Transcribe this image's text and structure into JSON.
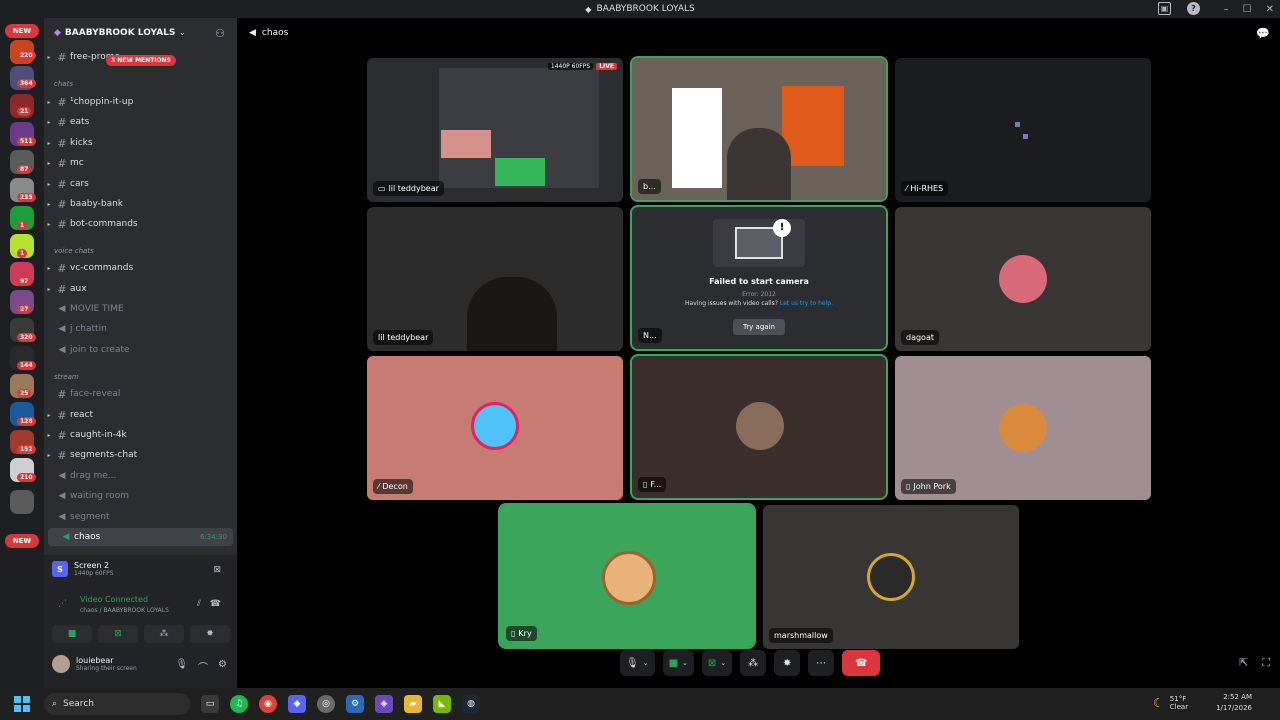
{
  "window": {
    "title": "BAABYBROOK LOYALS"
  },
  "rail": {
    "new_top": "NEW",
    "new_bottom": "NEW",
    "badges": [
      "220",
      "364",
      "21",
      "511",
      "87",
      "235",
      "1",
      "1",
      "97",
      "27",
      "320",
      "144",
      "25",
      "128",
      "152",
      "210"
    ]
  },
  "sidebar": {
    "guild_name": "BAABYBROOK LOYALS",
    "mentions_pill": "3 NEW MENTIONS",
    "channels": [
      {
        "name": "free-promo",
        "type": "text"
      },
      {
        "name": "chats",
        "type": "category"
      },
      {
        "name": "¹choppin-it-up",
        "type": "text"
      },
      {
        "name": "eats",
        "type": "text"
      },
      {
        "name": "kicks",
        "type": "text"
      },
      {
        "name": "mc",
        "type": "text"
      },
      {
        "name": "cars",
        "type": "text"
      },
      {
        "name": "baaby-bank",
        "type": "text"
      },
      {
        "name": "bot-commands",
        "type": "text"
      },
      {
        "name": "voice chats",
        "type": "category"
      },
      {
        "name": "vc-commands",
        "type": "text"
      },
      {
        "name": "aux",
        "type": "text"
      },
      {
        "name": "MOVIE TIME",
        "type": "voice"
      },
      {
        "name": "j chattin",
        "type": "voice"
      },
      {
        "name": "join to create",
        "type": "voice"
      },
      {
        "name": "stream",
        "type": "category"
      },
      {
        "name": "face-reveal",
        "type": "text"
      },
      {
        "name": "react",
        "type": "text"
      },
      {
        "name": "caught-in-4k",
        "type": "text"
      },
      {
        "name": "segments-chat",
        "type": "text"
      },
      {
        "name": "drag me...",
        "type": "voice"
      },
      {
        "name": "waiting room",
        "type": "voice"
      },
      {
        "name": "segment",
        "type": "voice"
      },
      {
        "name": "chaos",
        "type": "voice-active",
        "timer": "6:34:30"
      }
    ]
  },
  "rtc": {
    "stream_title": "Screen 2",
    "stream_quality": "1440p 60FPS",
    "status": "Video Connected",
    "location": "chaos / BAABYBROOK LOYALS"
  },
  "user": {
    "name": "louiebear",
    "status": "Sharing their screen"
  },
  "main": {
    "channel": "chaos",
    "tiles": [
      {
        "label": "lil teddybear",
        "live": "LIVE",
        "quality": "1440P 60FPS"
      },
      {
        "label": "b..."
      },
      {
        "label": "Hi-RHES"
      },
      {
        "label": "lil teddybear"
      },
      {
        "label": "N..."
      },
      {
        "label": "dagoat"
      },
      {
        "label": "Decon"
      },
      {
        "label": "F..."
      },
      {
        "label": "John Pork"
      },
      {
        "label": "Kry"
      },
      {
        "label": "marshmallow"
      }
    ],
    "cam_fail": {
      "title": "Failed to start camera",
      "error": "Error: 2012",
      "help": "Having issues with video calls?",
      "link": "Let us try to help.",
      "button": "Try again"
    }
  },
  "taskbar": {
    "search": "Search",
    "temp": "51°F",
    "weather": "Clear",
    "time": "2:52 AM",
    "date": "1/17/2026"
  }
}
